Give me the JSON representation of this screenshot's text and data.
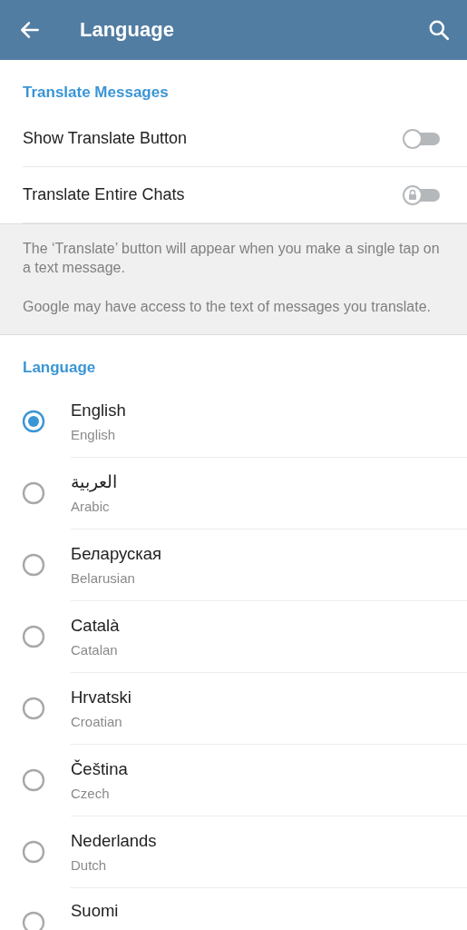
{
  "header": {
    "title": "Language"
  },
  "translate_section": {
    "title": "Translate Messages",
    "toggles": [
      {
        "label": "Show Translate Button",
        "on": false,
        "locked": false
      },
      {
        "label": "Translate Entire Chats",
        "on": false,
        "locked": true
      }
    ]
  },
  "info": [
    "The ‘Translate’ button will appear when you make a single tap on a text message.",
    "Google may have access to the text of messages you translate."
  ],
  "language_section": {
    "title": "Language",
    "languages": [
      {
        "name": "English",
        "subtitle": "English",
        "selected": true
      },
      {
        "name": "العربية",
        "subtitle": "Arabic",
        "selected": false
      },
      {
        "name": "Беларуская",
        "subtitle": "Belarusian",
        "selected": false
      },
      {
        "name": "Català",
        "subtitle": "Catalan",
        "selected": false
      },
      {
        "name": "Hrvatski",
        "subtitle": "Croatian",
        "selected": false
      },
      {
        "name": "Čeština",
        "subtitle": "Czech",
        "selected": false
      },
      {
        "name": "Nederlands",
        "subtitle": "Dutch",
        "selected": false
      },
      {
        "name": "Suomi",
        "selected": false
      }
    ]
  }
}
